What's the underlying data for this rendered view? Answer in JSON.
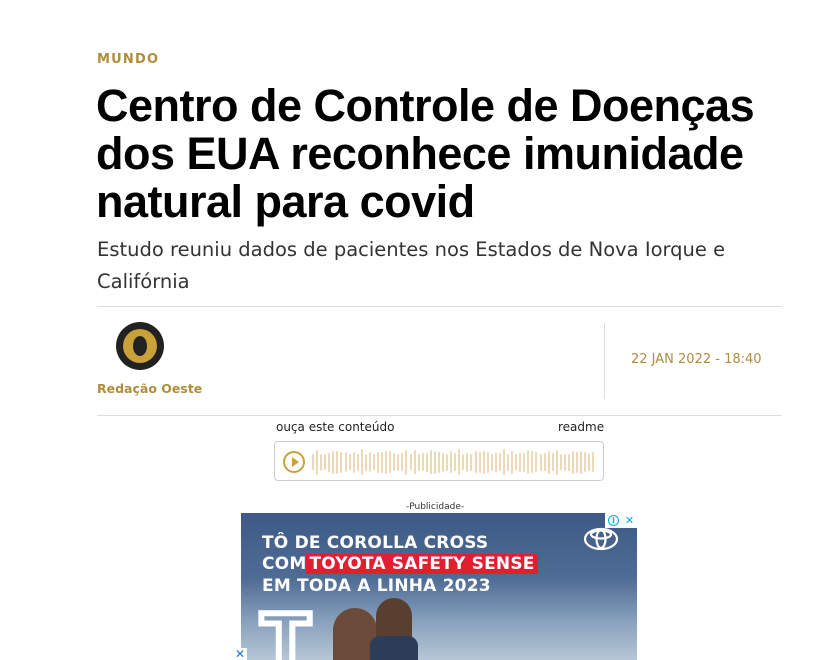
{
  "article": {
    "section": "MUNDO",
    "headline": "Centro de Controle de Doenças dos EUA reconhece imunidade natural para covid",
    "subtitle": "Estudo reuniu dados de pacientes nos Estados de Nova Iorque e Califórnia",
    "author": "Redação Oeste",
    "date": "22 JAN 2022 - 18:40"
  },
  "audio": {
    "listen_label": "ouça este conteúdo",
    "provider": "readme",
    "play_icon": "play-icon"
  },
  "ad": {
    "label": "-Publicidade-",
    "line1": "TÔ DE COROLLA CROSS",
    "line2_prefix": "COM",
    "line2_highlight": "TOYOTA SAFETY SENSE",
    "line3": "EM TODA A LINHA 2023",
    "adchoices_info": "i",
    "adchoices_close": "✕",
    "close": "✕"
  },
  "colors": {
    "accent": "#b08d3a",
    "waveform": "#ecd9b6",
    "ad_highlight": "#e0202e"
  }
}
